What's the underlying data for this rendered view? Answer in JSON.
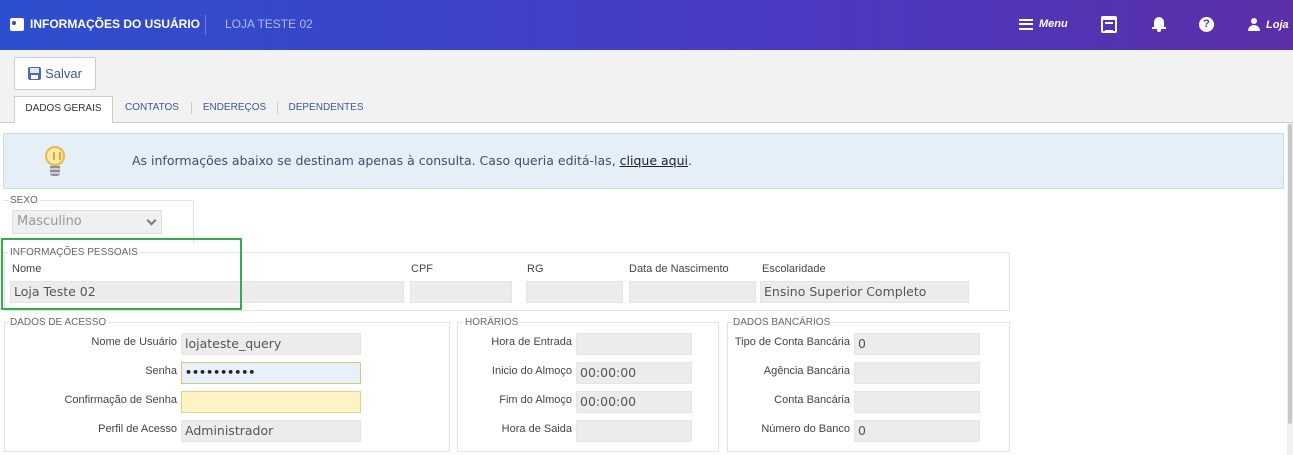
{
  "header": {
    "title": "INFORMAÇÕES DO USUÁRIO",
    "store": "LOJA TESTE 02",
    "menu_label": "Menu",
    "user_label": "Loja",
    "help_glyph": "?"
  },
  "toolbar": {
    "save_label": "Salvar"
  },
  "tabs": [
    {
      "label": "DADOS GERAIS",
      "active": true
    },
    {
      "label": "CONTATOS",
      "active": false
    },
    {
      "label": "ENDEREÇOS",
      "active": false
    },
    {
      "label": "DEPENDENTES",
      "active": false
    }
  ],
  "info": {
    "text": "As informações abaixo se destinam apenas à consulta. Caso queria editá-las, ",
    "link": "clique aqui",
    "end": "."
  },
  "sexo": {
    "legend": "SEXO",
    "value": "Masculino"
  },
  "pessoais": {
    "legend": "INFORMAÇÕES PESSOAIS",
    "nome_label": "Nome",
    "nome_value": "Loja Teste 02",
    "cpf_label": "CPF",
    "cpf_value": "",
    "rg_label": "RG",
    "rg_value": "",
    "nasc_label": "Data de Nascimento",
    "nasc_value": "",
    "esc_label": "Escolaridade",
    "esc_value": "Ensino Superior Completo"
  },
  "acesso": {
    "legend": "DADOS DE ACESSO",
    "usuario_label": "Nome de Usuário",
    "usuario_value": "lojateste_query",
    "senha_label": "Senha",
    "senha_value": "••••••••••",
    "conf_label": "Confirmação de Senha",
    "conf_value": "",
    "perfil_label": "Perfil de Acesso",
    "perfil_value": "Administrador"
  },
  "horarios": {
    "legend": "HORÁRIOS",
    "entrada_label": "Hora de Entrada",
    "entrada_value": "",
    "inicio_label": "Inicio do Almoço",
    "inicio_value": "00:00:00",
    "fim_label": "Fim do Almoço",
    "fim_value": "00:00:00",
    "saida_label": "Hora de Saida",
    "saida_value": ""
  },
  "bancarios": {
    "legend": "DADOS BANCÁRIOS",
    "tipo_label": "Tipo de Conta Bancária",
    "tipo_value": "0",
    "agencia_label": "Agência Bancária",
    "agencia_value": "",
    "conta_label": "Conta Bancária",
    "conta_value": "",
    "numero_label": "Número do Banco",
    "numero_value": "0"
  },
  "colors": {
    "topbar_start": "#2c4fcf",
    "topbar_end": "#5a2fa8",
    "highlight": "#2fae4e",
    "info_bg": "#e5eff8"
  }
}
